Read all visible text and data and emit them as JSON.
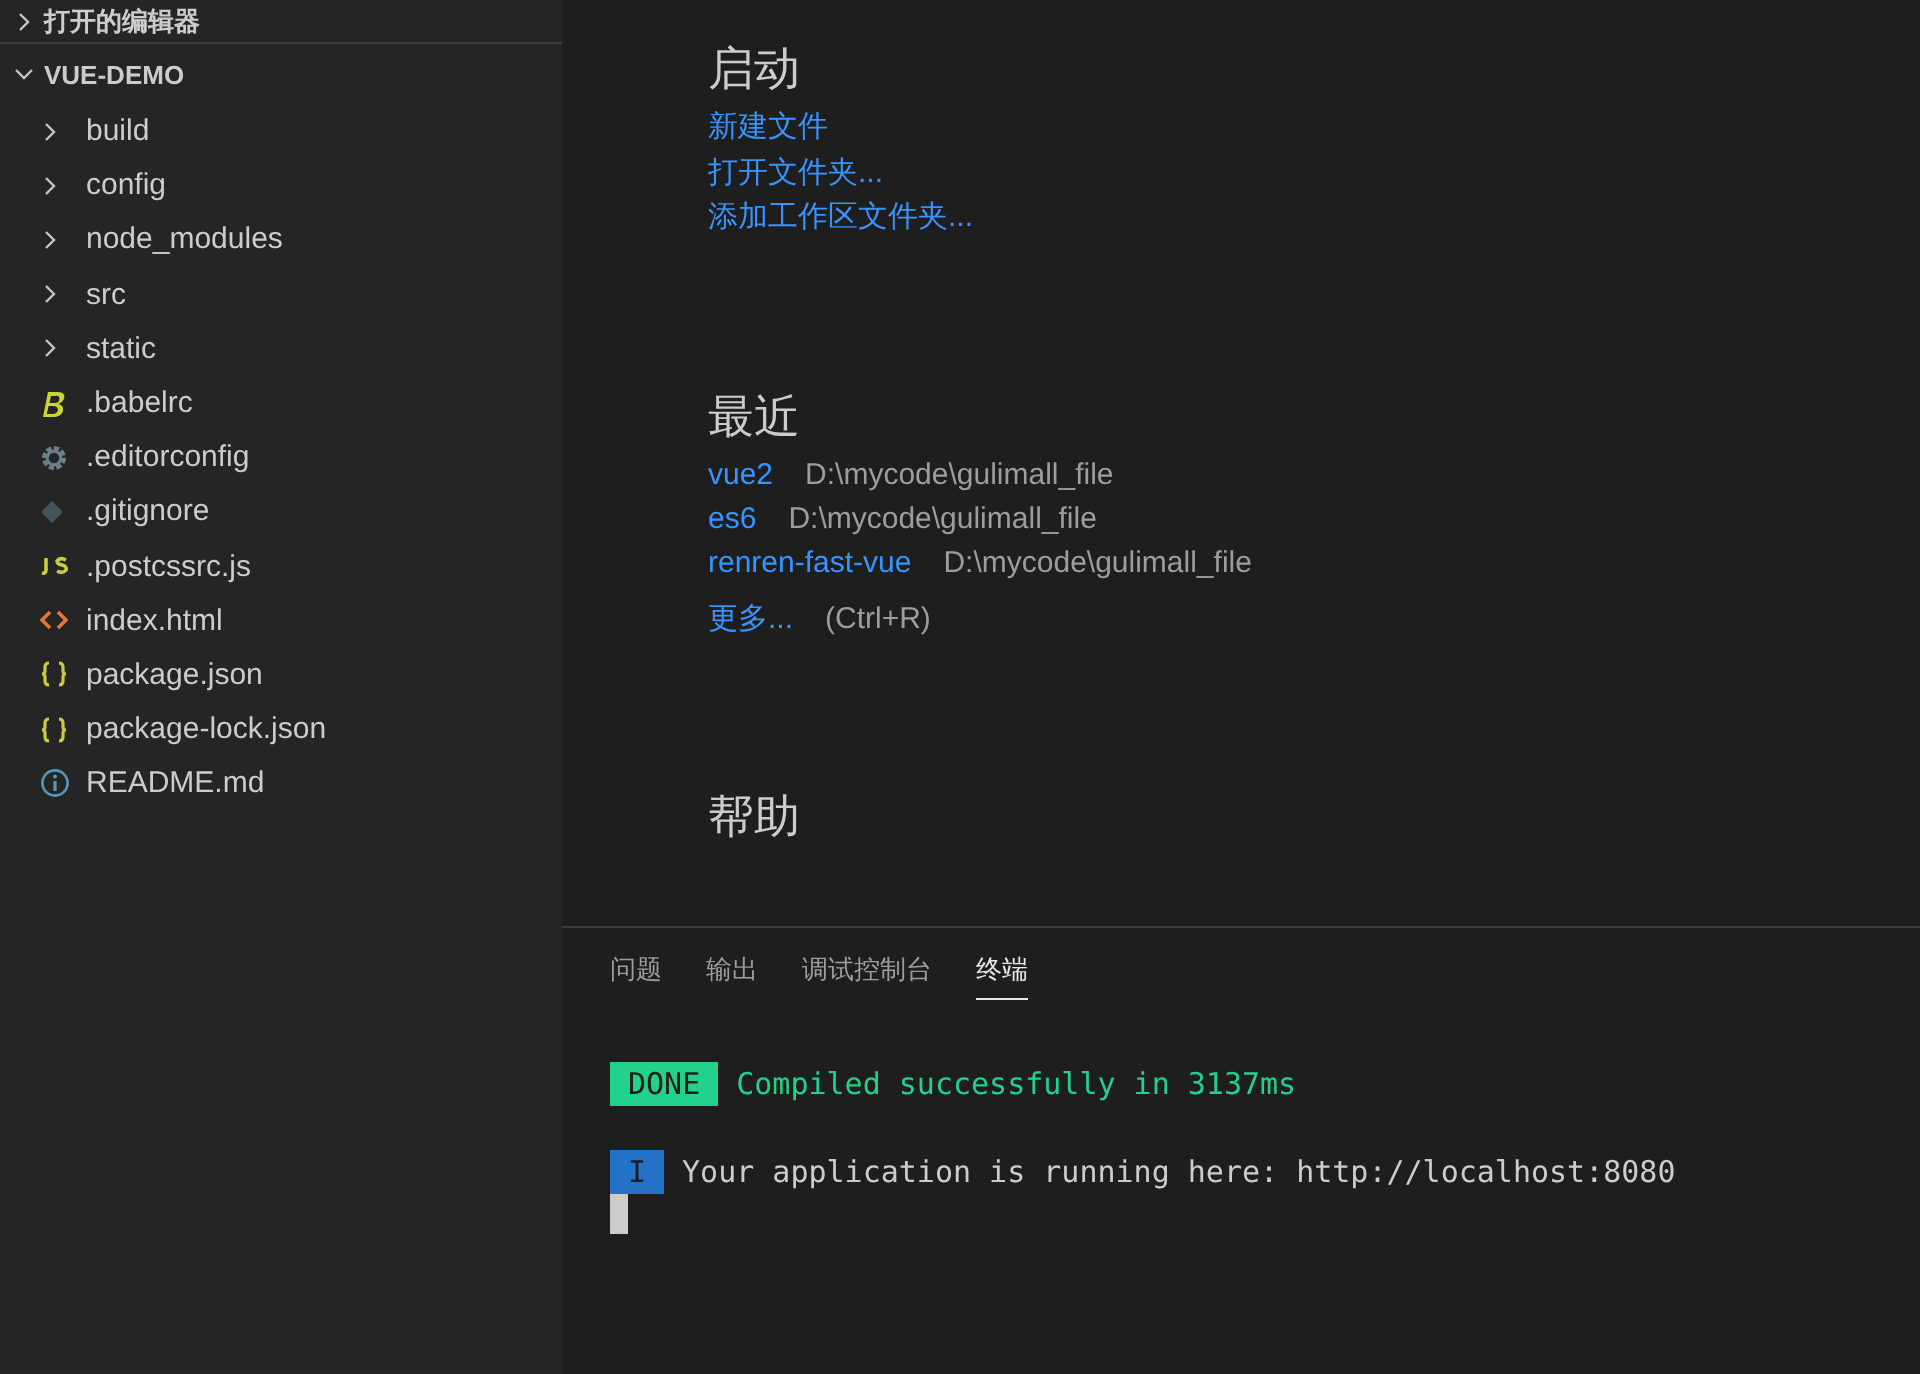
{
  "sidebar": {
    "sections": [
      {
        "title": "打开的编辑器",
        "expanded": false
      },
      {
        "title": "VUE-DEMO",
        "expanded": true,
        "items": [
          {
            "label": "build",
            "kind": "folder",
            "expanded": false
          },
          {
            "label": "config",
            "kind": "folder",
            "expanded": false
          },
          {
            "label": "node_modules",
            "kind": "folder",
            "expanded": false
          },
          {
            "label": "src",
            "kind": "folder",
            "expanded": false
          },
          {
            "label": "static",
            "kind": "folder",
            "expanded": false
          },
          {
            "label": ".babelrc",
            "kind": "babel"
          },
          {
            "label": ".editorconfig",
            "kind": "config"
          },
          {
            "label": ".gitignore",
            "kind": "git"
          },
          {
            "label": ".postcssrc.js",
            "kind": "js"
          },
          {
            "label": "index.html",
            "kind": "html"
          },
          {
            "label": "package.json",
            "kind": "json"
          },
          {
            "label": "package-lock.json",
            "kind": "json"
          },
          {
            "label": "README.md",
            "kind": "info"
          }
        ]
      }
    ]
  },
  "welcome": {
    "start": {
      "title": "启动",
      "links": [
        "新建文件",
        "打开文件夹...",
        "添加工作区文件夹..."
      ]
    },
    "recent": {
      "title": "最近",
      "items": [
        {
          "name": "vue2",
          "path": "D:\\mycode\\gulimall_file"
        },
        {
          "name": "es6",
          "path": "D:\\mycode\\gulimall_file"
        },
        {
          "name": "renren-fast-vue",
          "path": "D:\\mycode\\gulimall_file"
        }
      ],
      "more": {
        "label": "更多...",
        "shortcut": "(Ctrl+R)"
      }
    },
    "help": {
      "title": "帮助"
    }
  },
  "panel": {
    "tabs": [
      {
        "label": "问题",
        "selected": false
      },
      {
        "label": "输出",
        "selected": false
      },
      {
        "label": "调试控制台",
        "selected": false
      },
      {
        "label": "终端",
        "selected": true
      }
    ],
    "terminal": [
      {
        "badge": "DONE",
        "kind": "done",
        "text": "Compiled successfully in 3137ms"
      },
      {
        "badge": "I",
        "kind": "info",
        "text": "Your application is running here: http://localhost:8080"
      }
    ]
  }
}
